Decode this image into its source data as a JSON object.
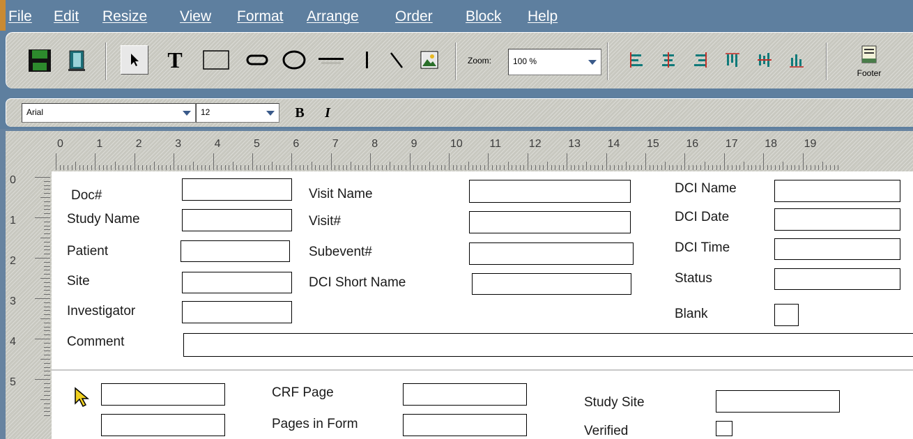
{
  "menu": [
    "File",
    "Edit",
    "Resize",
    "View",
    "Format",
    "Arrange",
    "Order",
    "Block",
    "Help"
  ],
  "toolbar": {
    "save_icon": "floppy-disk-icon",
    "exit_icon": "exit-door-icon",
    "select_icon": "arrow-select-icon",
    "text_icon": "text-tool-icon",
    "text_glyph": "T",
    "rect_icon": "rectangle-tool-icon",
    "ellipse_icon": "rounded-rectangle-icon",
    "circle_icon": "ellipse-tool-icon",
    "hline_icon": "horizontal-line-icon",
    "vline_icon": "vertical-line-icon",
    "dline_icon": "diagonal-line-icon",
    "image_icon": "image-tool-icon",
    "zoom_label": "Zoom:",
    "zoom_value": "100 %",
    "footer_label": "Footer"
  },
  "format": {
    "font_value": "Arial",
    "size_value": "12",
    "bold_glyph": "B",
    "italic_glyph": "I"
  },
  "ruler": {
    "h": [
      "0",
      "1",
      "2",
      "3",
      "4",
      "5",
      "6",
      "7",
      "8",
      "9",
      "10",
      "11",
      "12",
      "13",
      "14",
      "15",
      "16",
      "17",
      "18",
      "19"
    ],
    "v": [
      "0",
      "1",
      "2",
      "3",
      "4",
      "5"
    ]
  },
  "form": {
    "header_labels": {
      "doc": "Doc#",
      "study_name": "Study Name",
      "patient": "Patient",
      "site": "Site",
      "investigator": "Investigator",
      "comment": "Comment",
      "visit_name": "Visit Name",
      "visit_num": "Visit#",
      "subevent": "Subevent#",
      "dci_short": "DCI Short Name",
      "dci_name": "DCI Name",
      "dci_date": "DCI Date",
      "dci_time": "DCI Time",
      "status": "Status",
      "blank": "Blank"
    },
    "footer_labels": {
      "crf_page": "CRF Page",
      "pages_in_form": "Pages in Form",
      "study_site": "Study Site",
      "verified": "Verified"
    }
  },
  "colors": {
    "menubar": "#5e7f9f",
    "accent": "#c98a33",
    "align_red": "#c0302a",
    "align_teal": "#0f7a7a"
  }
}
